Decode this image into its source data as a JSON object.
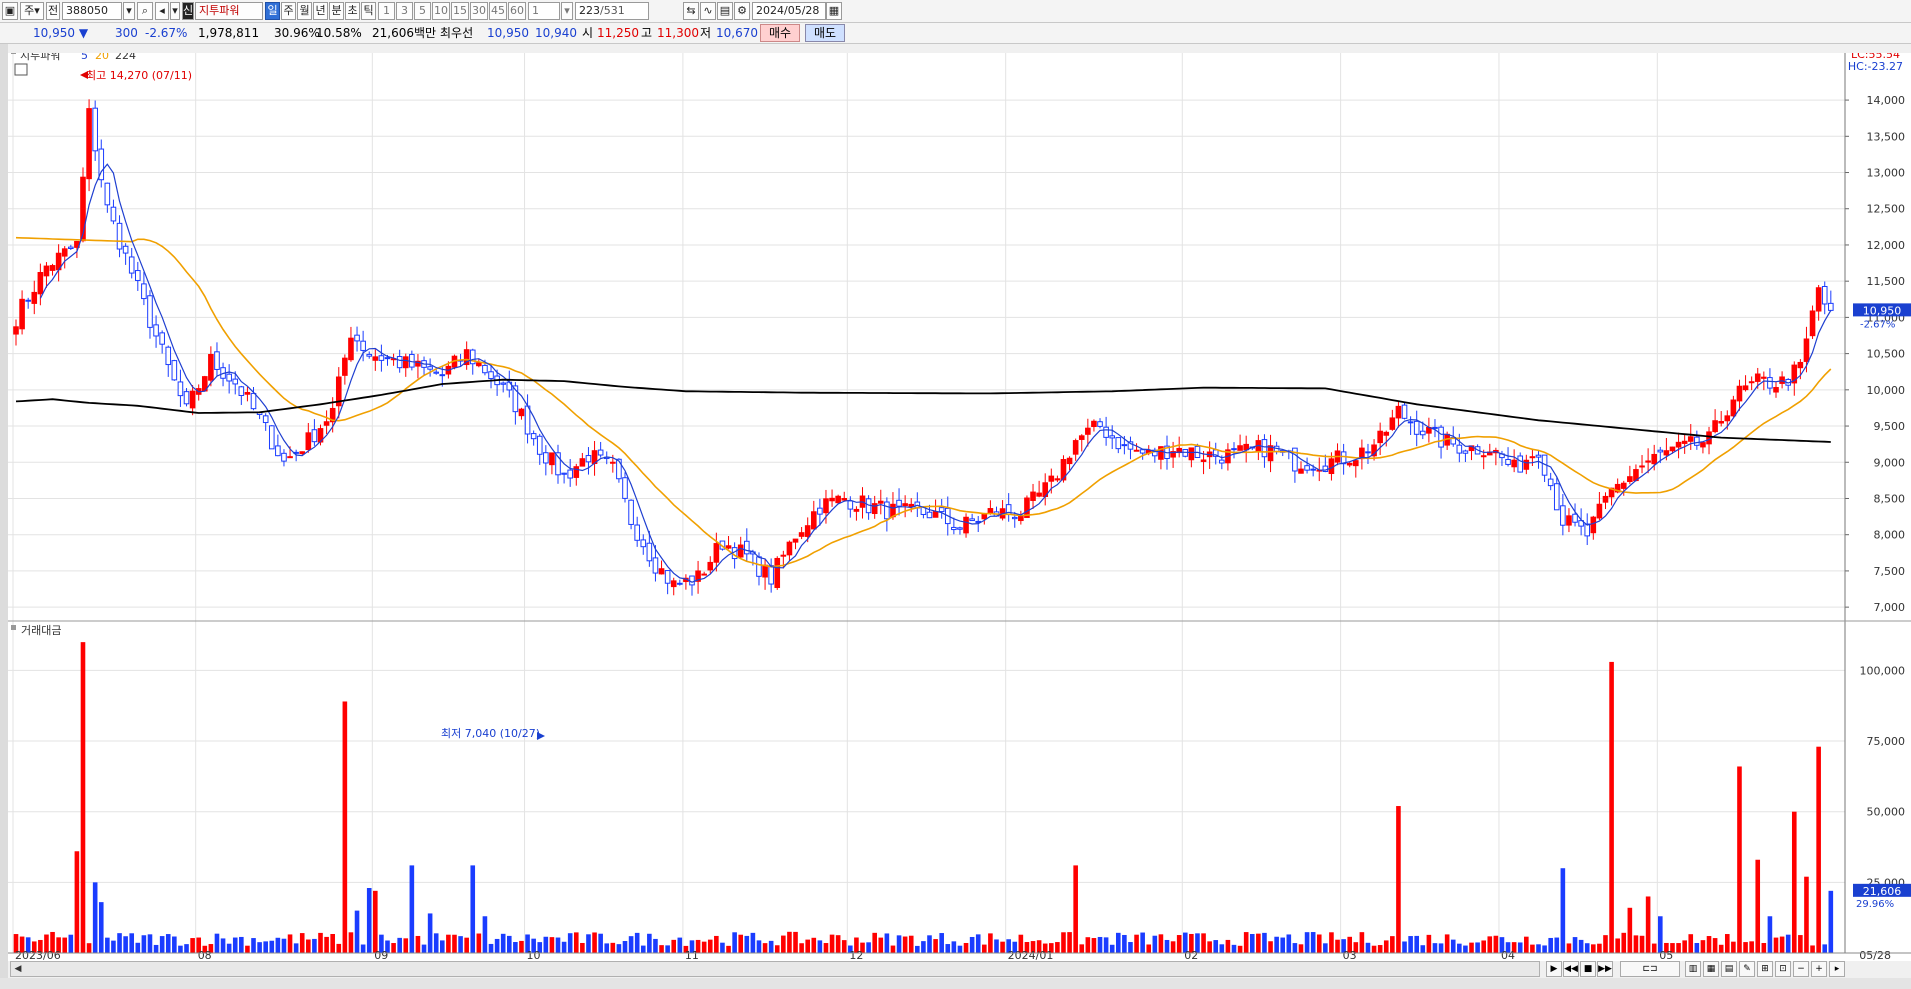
{
  "toolbar": {
    "period_label": "주",
    "mode_label": "전",
    "stock_code": "388050",
    "indicator_badge": "신",
    "indicator_name": "지투파워",
    "tabs": [
      "일",
      "주",
      "월",
      "년",
      "분",
      "초",
      "틱"
    ],
    "active_tab": "일",
    "intervals": [
      "1",
      "3",
      "5",
      "10",
      "15",
      "30",
      "45",
      "60"
    ],
    "interval_select": "1",
    "count": "223",
    "count_total": "/531",
    "date": "2024/05/28"
  },
  "infobar": {
    "price": "10,950",
    "change": "300",
    "change_pct": "-2.67%",
    "volume": "1,978,811",
    "turnover_ratio": "30.96%",
    "ratio2": "10.58%",
    "amount": "21,606백만",
    "best_label": "최우선",
    "best_ask": "10,950",
    "best_bid": "10,940",
    "open_label": "시",
    "open": "11,250",
    "high_label": "고",
    "high": "11,300",
    "low_label": "저",
    "low": "10,670",
    "buy_label": "매수",
    "sell_label": "매도"
  },
  "colors": {
    "up": "#ff0000",
    "down": "#1a3cff",
    "ma5": "#1f3fd0",
    "ma20": "#f0a000",
    "ma224": "#000000",
    "grid": "#e3e3e3"
  },
  "chart_data": {
    "type": "candlestick",
    "title": "지투파워",
    "legend": [
      "지투파워",
      "5",
      "20",
      "224"
    ],
    "ylim": [
      6850,
      14650
    ],
    "yticks": [
      7000,
      7500,
      8000,
      8500,
      9000,
      9500,
      10000,
      10500,
      11000,
      11500,
      12000,
      12500,
      13000,
      13500,
      14000
    ],
    "ytick_labels": [
      "7,000",
      "7,500",
      "8,000",
      "8,500",
      "9,000",
      "9,500",
      "10,000",
      "10,500",
      "11,000",
      "11,500",
      "12,000",
      "12,500",
      "13,000",
      "13,500",
      "14,000"
    ],
    "xlabels": [
      "2023/06",
      "08",
      "09",
      "10",
      "11",
      "12",
      "2024/01",
      "02",
      "03",
      "04",
      "05",
      "05/28"
    ],
    "xlabel_index": [
      0,
      30,
      59,
      84,
      110,
      137,
      163,
      192,
      218,
      244,
      270,
      305
    ],
    "lc_label": "LC:55.54",
    "hc_label": "HC:-23.27",
    "last_price_label": "10,950",
    "last_change_label": "-2.67%",
    "high_annotation": "최고 14,270 (07/11)",
    "low_annotation": "최저 7,040 (10/27)",
    "anchors": [
      [
        0,
        11000
      ],
      [
        5,
        11700
      ],
      [
        10,
        12000
      ],
      [
        12,
        13800
      ],
      [
        15,
        12500
      ],
      [
        20,
        11400
      ],
      [
        25,
        10300
      ],
      [
        28,
        9700
      ],
      [
        32,
        10400
      ],
      [
        36,
        10100
      ],
      [
        40,
        9600
      ],
      [
        44,
        9000
      ],
      [
        48,
        9300
      ],
      [
        52,
        9700
      ],
      [
        55,
        10800
      ],
      [
        58,
        10500
      ],
      [
        62,
        10400
      ],
      [
        66,
        10300
      ],
      [
        70,
        10200
      ],
      [
        74,
        10500
      ],
      [
        78,
        10200
      ],
      [
        82,
        9800
      ],
      [
        86,
        9200
      ],
      [
        90,
        8800
      ],
      [
        94,
        9100
      ],
      [
        98,
        8900
      ],
      [
        101,
        8200
      ],
      [
        105,
        7600
      ],
      [
        108,
        7300
      ],
      [
        112,
        7400
      ],
      [
        116,
        7900
      ],
      [
        120,
        7700
      ],
      [
        124,
        7400
      ],
      [
        128,
        8000
      ],
      [
        132,
        8400
      ],
      [
        136,
        8500
      ],
      [
        140,
        8400
      ],
      [
        145,
        8300
      ],
      [
        150,
        8300
      ],
      [
        155,
        8100
      ],
      [
        160,
        8300
      ],
      [
        165,
        8300
      ],
      [
        170,
        8700
      ],
      [
        174,
        9300
      ],
      [
        178,
        9500
      ],
      [
        182,
        9200
      ],
      [
        186,
        9100
      ],
      [
        190,
        9200
      ],
      [
        195,
        9100
      ],
      [
        200,
        9100
      ],
      [
        205,
        9200
      ],
      [
        210,
        9000
      ],
      [
        215,
        9000
      ],
      [
        220,
        9100
      ],
      [
        224,
        9300
      ],
      [
        227,
        9700
      ],
      [
        230,
        9500
      ],
      [
        234,
        9300
      ],
      [
        238,
        9200
      ],
      [
        242,
        9200
      ],
      [
        246,
        8900
      ],
      [
        250,
        9200
      ],
      [
        254,
        8200
      ],
      [
        258,
        8000
      ],
      [
        262,
        8600
      ],
      [
        266,
        8900
      ],
      [
        270,
        9100
      ],
      [
        274,
        9200
      ],
      [
        278,
        9300
      ],
      [
        282,
        9900
      ],
      [
        286,
        10100
      ],
      [
        290,
        10100
      ],
      [
        293,
        10300
      ],
      [
        296,
        11400
      ],
      [
        298,
        11000
      ]
    ],
    "ma224_anchors": [
      [
        0,
        9840
      ],
      [
        6,
        9870
      ],
      [
        12,
        9820
      ],
      [
        20,
        9780
      ],
      [
        30,
        9680
      ],
      [
        40,
        9690
      ],
      [
        50,
        9800
      ],
      [
        60,
        9930
      ],
      [
        70,
        10080
      ],
      [
        80,
        10140
      ],
      [
        90,
        10120
      ],
      [
        100,
        10040
      ],
      [
        110,
        9980
      ],
      [
        130,
        9960
      ],
      [
        160,
        9950
      ],
      [
        180,
        9980
      ],
      [
        195,
        10030
      ],
      [
        215,
        10020
      ],
      [
        230,
        9800
      ],
      [
        250,
        9580
      ],
      [
        265,
        9460
      ],
      [
        280,
        9340
      ],
      [
        298,
        9280
      ]
    ],
    "volume_panel": {
      "title": "거래대금",
      "ylim": [
        0,
        115000
      ],
      "yticks": [
        25000,
        50000,
        75000,
        100000
      ],
      "ytick_labels": [
        "25,000",
        "50,000",
        "75,000",
        "100,000"
      ],
      "last_value_label": "21,606",
      "last_pct_label": "29.96%",
      "spikes": [
        [
          10,
          36000
        ],
        [
          11,
          110000
        ],
        [
          13,
          25000
        ],
        [
          14,
          18000
        ],
        [
          54,
          89000
        ],
        [
          56,
          15000
        ],
        [
          58,
          23000
        ],
        [
          59,
          22000
        ],
        [
          65,
          31000
        ],
        [
          68,
          14000
        ],
        [
          75,
          31000
        ],
        [
          77,
          13000
        ],
        [
          174,
          31000
        ],
        [
          227,
          52000
        ],
        [
          254,
          30000
        ],
        [
          262,
          103000
        ],
        [
          265,
          16000
        ],
        [
          268,
          20000
        ],
        [
          270,
          13000
        ],
        [
          283,
          66000
        ],
        [
          286,
          33000
        ],
        [
          288,
          13000
        ],
        [
          292,
          50000
        ],
        [
          294,
          27000
        ],
        [
          296,
          73000
        ],
        [
          298,
          22000
        ]
      ]
    }
  }
}
